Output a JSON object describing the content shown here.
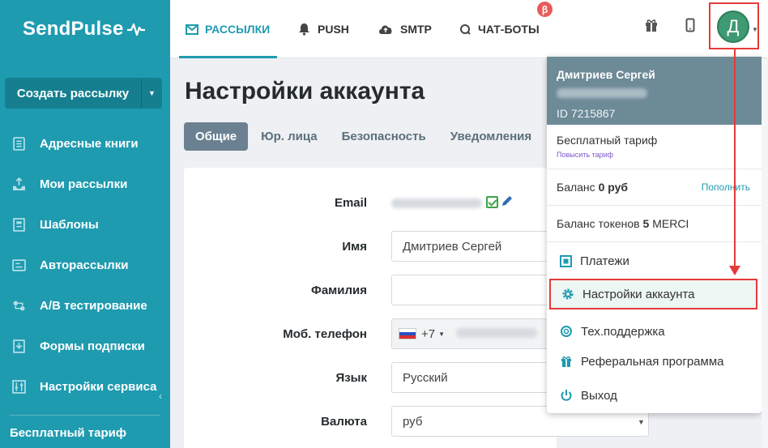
{
  "brand": {
    "logo_text": "SendPulse"
  },
  "sidebar": {
    "create_label": "Создать рассылку",
    "items": [
      {
        "label": "Адресные книги",
        "icon": "address-book-icon"
      },
      {
        "label": "Мои рассылки",
        "icon": "campaigns-icon"
      },
      {
        "label": "Шаблоны",
        "icon": "templates-icon"
      },
      {
        "label": "Авторассылки",
        "icon": "automation-icon"
      },
      {
        "label": "A/B тестирование",
        "icon": "ab-test-icon"
      },
      {
        "label": "Формы подписки",
        "icon": "subscription-form-icon"
      },
      {
        "label": "Настройки сервиса",
        "icon": "settings-sliders-icon"
      }
    ],
    "plan_label": "Бесплатный тариф"
  },
  "topnav": {
    "items": [
      {
        "label": "РАССЫЛКИ",
        "icon": "envelope-icon",
        "active": true
      },
      {
        "label": "PUSH",
        "icon": "bell-icon"
      },
      {
        "label": "SMTP",
        "icon": "cloud-upload-icon"
      },
      {
        "label": "ЧАТ-БОТЫ",
        "icon": "chat-icon"
      }
    ],
    "beta_badge": "β",
    "avatar_letter": "Д"
  },
  "page": {
    "title": "Настройки аккаунта",
    "tabs": [
      "Общие",
      "Юр. лица",
      "Безопасность",
      "Уведомления"
    ]
  },
  "form": {
    "email_label": "Email",
    "name_label": "Имя",
    "name_value": "Дмитриев Сергей",
    "surname_label": "Фамилия",
    "surname_value": "",
    "phone_label": "Моб. телефон",
    "phone_code": "+7",
    "language_label": "Язык",
    "language_value": "Русский",
    "currency_label": "Валюта",
    "currency_value": "руб"
  },
  "account_menu": {
    "user_name": "Дмитриев Сергей",
    "user_id": "ID 7215867",
    "plan": "Бесплатный тариф",
    "upgrade": "Повысить тариф",
    "balance_prefix": "Баланс ",
    "balance_value": "0 руб",
    "topup": "Пополнить",
    "tokens_prefix": "Баланс токенов ",
    "tokens_value": "5",
    "tokens_suffix": " MERCI",
    "items": [
      {
        "label": "Платежи",
        "icon": "payments-icon"
      },
      {
        "label": "Настройки аккаунта",
        "icon": "gear-icon"
      },
      {
        "label": "Тех.поддержка",
        "icon": "lifebuoy-icon"
      },
      {
        "label": "Реферальная программа",
        "icon": "gift-icon"
      },
      {
        "label": "Выход",
        "icon": "power-icon"
      }
    ]
  },
  "colors": {
    "sidebar": "#1f9bb0",
    "accent": "#1f9bb0",
    "highlight": "#e53a3a",
    "menu_header": "#6d8a97"
  }
}
